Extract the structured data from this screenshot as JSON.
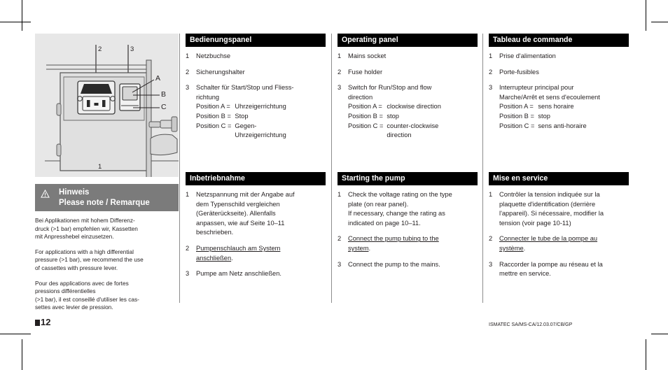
{
  "page": {
    "number": "12",
    "footer": "ISMATEC SA/MS-CA/12.03.07/CB/GP"
  },
  "figure": {
    "caption_labels": [
      "1",
      "2",
      "3",
      "A",
      "B",
      "C"
    ],
    "label_1": "1",
    "label_2": "2",
    "label_3": "3",
    "label_a": "A",
    "label_b": "B",
    "label_c": "C"
  },
  "note": {
    "icon": "warning-triangle-icon",
    "title_de": "Hinweis",
    "title_en_fr": "Please note / Remarque",
    "paragraph_de": "Bei Applikationen mit hohem Differenz-\ndruck (>1 bar) empfehlen wir, Kassetten\nmit Anpresshebel einzusetzen.",
    "paragraph_en": "For applications with a high differential\npressure (>1 bar), we recommend the use\nof cassettes with pressure lever.",
    "paragraph_fr": "Pour des applications avec de fortes\npressions différentielles\n(>1 bar), il est conseillé d'utiliser les cas-\nsettes avec levier de pression."
  },
  "columns": {
    "de": {
      "panel": {
        "heading": "Bedienungspanel",
        "items": [
          {
            "num": "1",
            "text": "Netzbuchse"
          },
          {
            "num": "2",
            "text": "Sicherungshalter"
          },
          {
            "num": "3",
            "text": "Schalter für Start/Stop und Fliess-\nrichtung"
          }
        ],
        "positions": [
          {
            "label": "Position A =",
            "value": "Uhrzeigerrichtung"
          },
          {
            "label": "Position B =",
            "value": "Stop"
          },
          {
            "label": "Position C =",
            "value": "Gegen-"
          },
          {
            "label": "",
            "value": "Uhrzeigerrichtung"
          }
        ]
      },
      "start": {
        "heading": "Inbetriebnahme",
        "items": [
          {
            "num": "1",
            "text": "Netzspannung mit der Angabe auf\ndem Typenschild vergleichen\n(Geräterückseite). Allenfalls\nanpassen, wie auf Seite 10–11\nbeschrieben.",
            "underline": false
          },
          {
            "num": "2",
            "text": "Pumpenschlauch am System\nanschließen",
            "underline": true,
            "trailing": "."
          },
          {
            "num": "3",
            "text": "Pumpe am Netz anschließen.",
            "underline": false
          }
        ]
      }
    },
    "en": {
      "panel": {
        "heading": "Operating panel",
        "items": [
          {
            "num": "1",
            "text": "Mains socket"
          },
          {
            "num": "2",
            "text": "Fuse holder"
          },
          {
            "num": "3",
            "text": "Switch for Run/Stop and flow\ndirection"
          }
        ],
        "positions": [
          {
            "label": "Position A =",
            "value": "clockwise direction"
          },
          {
            "label": "Position B =",
            "value": "stop"
          },
          {
            "label": "Position C =",
            "value": "counter-clockwise"
          },
          {
            "label": "",
            "value": "direction"
          }
        ]
      },
      "start": {
        "heading": "Starting the pump",
        "items": [
          {
            "num": "1",
            "text": "Check the voltage rating on the type\nplate (on rear panel).\nIf necessary, change the rating as\nindicated on page 10–11.",
            "underline": false
          },
          {
            "num": "2",
            "text": "Connect the pump tubing to the\nsystem",
            "underline": true,
            "trailing": "."
          },
          {
            "num": "3",
            "text": "Connect the pump to the mains.",
            "underline": false
          }
        ]
      }
    },
    "fr": {
      "panel": {
        "heading": "Tableau de commande",
        "items": [
          {
            "num": "1",
            "text": "Prise d'alimentation"
          },
          {
            "num": "2",
            "text": "Porte-fusibles"
          },
          {
            "num": "3",
            "text": "Interrupteur principal pour\nMarche/Arrêt et sens d'ecoulement"
          }
        ],
        "positions": [
          {
            "label": "Position A =",
            "value": "sens horaire"
          },
          {
            "label": "Position B =",
            "value": "stop"
          },
          {
            "label": "Position C =",
            "value": "sens anti-horaire"
          }
        ]
      },
      "start": {
        "heading": "Mise en service",
        "items": [
          {
            "num": "1",
            "text": "Contrôler la tension indiquée sur la\nplaquette d'identification (derrière\nl'appareil). Si nécessaire, modifier la\ntension (voir page 10-11)",
            "underline": false
          },
          {
            "num": "2",
            "text": "Connecter le tube de la pompe au\nsystème",
            "underline": true,
            "trailing": "."
          },
          {
            "num": "3",
            "text": "Raccorder la pompe au réseau et la\nmettre en service.",
            "underline": false
          }
        ]
      }
    }
  }
}
